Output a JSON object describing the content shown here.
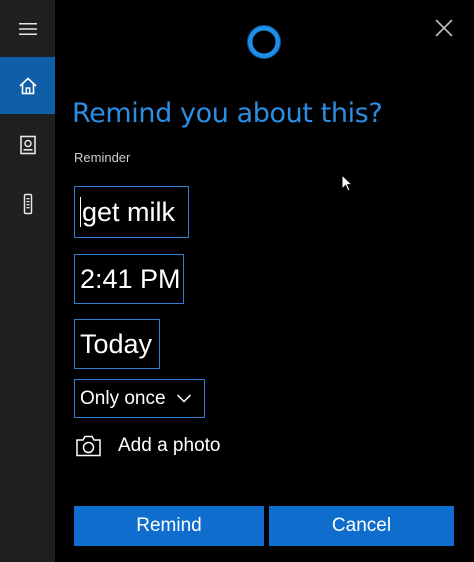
{
  "sidebar": {
    "items": [
      {
        "icon": "hamburger-menu-icon"
      },
      {
        "icon": "home-icon",
        "active": true
      },
      {
        "icon": "notebook-icon"
      },
      {
        "icon": "device-icon"
      }
    ],
    "active_color": "#0f5fa8"
  },
  "header": {
    "close_icon": "close-icon",
    "logo_icon": "cortana-ring-icon"
  },
  "title": "Remind you about this?",
  "reminder_label": "Reminder",
  "fields": {
    "subject": "get milk",
    "time": "2:41 PM",
    "date": "Today"
  },
  "repeat": {
    "selected": "Only once"
  },
  "photo": {
    "label": "Add a photo",
    "icon": "camera-icon"
  },
  "buttons": {
    "remind": "Remind",
    "cancel": "Cancel"
  },
  "colors": {
    "accent": "#2b8ee3",
    "button": "#0f6ecd",
    "background": "#000000"
  }
}
